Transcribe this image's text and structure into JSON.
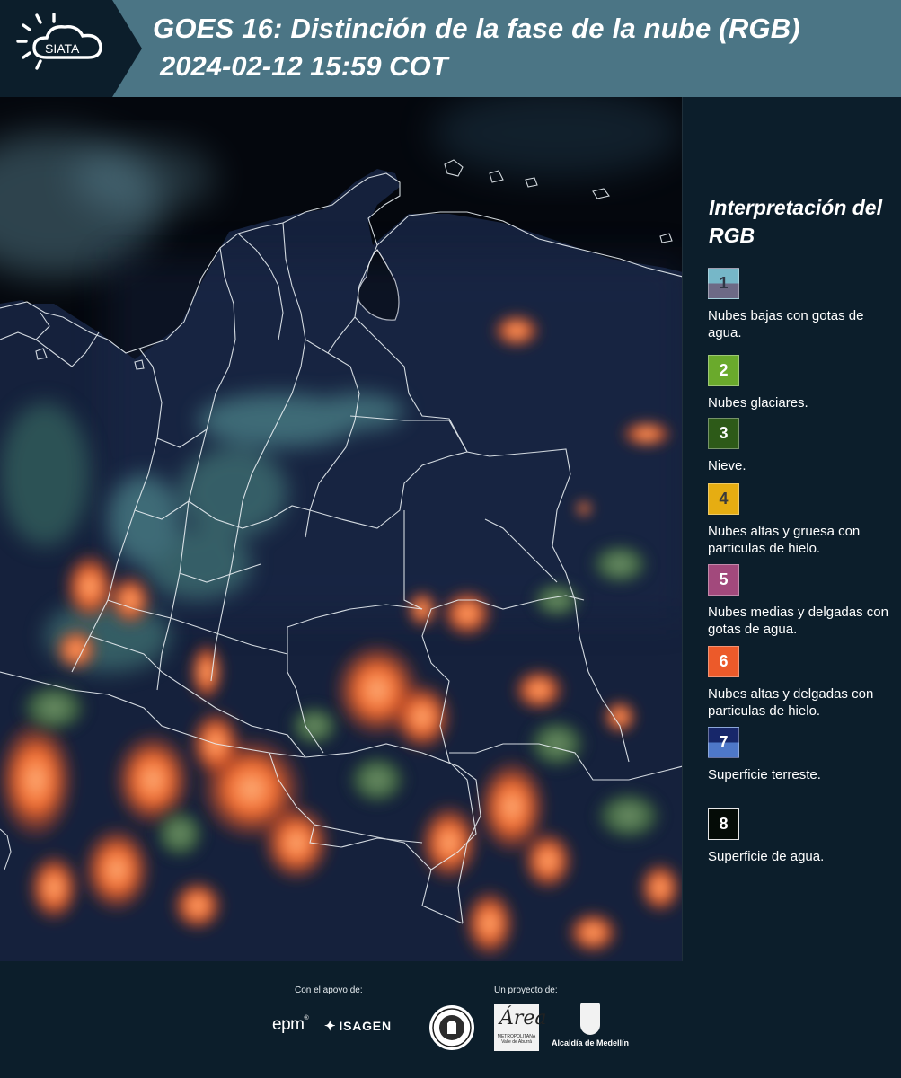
{
  "header": {
    "logo_text": "SIATA",
    "title_line1": "GOES 16: Distinción de la fase de la nube (RGB)",
    "title_line2": "2024-02-12 15:59 COT"
  },
  "legend": {
    "title": "Interpretación del RGB",
    "items": [
      {
        "number": "1",
        "label": "Nubes bajas con gotas de agua.",
        "color_top": "#76b7c8",
        "color_bottom": "#6d6a86",
        "text_color": "#2f3746"
      },
      {
        "number": "2",
        "label": "Nubes glaciares.",
        "color": "#6aaa2c",
        "text_color": "#ffffff"
      },
      {
        "number": "3",
        "label": "Nieve.",
        "color": "#2d5a18",
        "text_color": "#ffffff"
      },
      {
        "number": "4",
        "label": "Nubes altas y gruesa con particulas de hielo.",
        "color": "#e6ad12",
        "text_color": "#3a3a3a"
      },
      {
        "number": "5",
        "label": "Nubes medias y delgadas con gotas de agua.",
        "color": "#a2497c",
        "text_color": "#ffffff"
      },
      {
        "number": "6",
        "label": "Nubes altas y delgadas con particulas de hielo.",
        "color": "#ec5a2a",
        "text_color": "#ffffff"
      },
      {
        "number": "7",
        "label": "Superficie terreste.",
        "color_top": "#17276a",
        "color_bottom": "#4e78c8",
        "text_color": "#ffffff"
      },
      {
        "number": "8",
        "label": "Superficie de agua.",
        "color": "#050c07",
        "text_color": "#ffffff"
      }
    ]
  },
  "footer": {
    "support_label": "Con el apoyo de:",
    "project_label": "Un proyecto de:",
    "sponsors": [
      "epm",
      "ISAGEN"
    ],
    "area_logo_letter": "Área",
    "area_logo_subtitle": "METROPOLITANA Valle de Aburrá",
    "alcaldia_label": "Alcaldía de Medellín"
  },
  "colors": {
    "header_bg": "#4b7585",
    "panel_bg": "#0c1e2b",
    "ocean": "#04070d",
    "land": "#14213d",
    "cloud_warm": "#ec5a2a",
    "cloud_glacial": "#6aaa2c",
    "cloud_low": "#76b7c8"
  }
}
